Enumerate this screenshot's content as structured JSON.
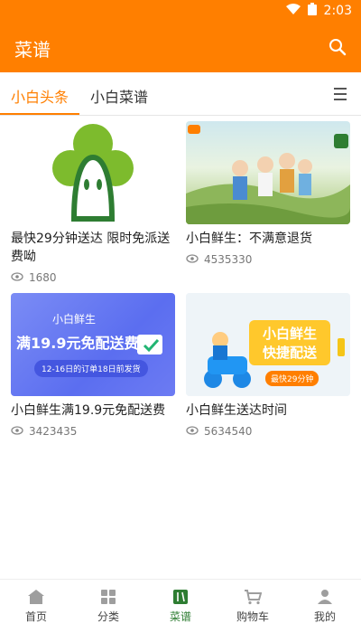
{
  "status": {
    "time": "2:03"
  },
  "app": {
    "title": "菜谱"
  },
  "tabs": [
    {
      "label": "小白头条"
    },
    {
      "label": "小白菜谱"
    }
  ],
  "cards": [
    {
      "title": "最快29分钟送达 限时免派送费呦",
      "views": "1680",
      "image": "green-brand-logo"
    },
    {
      "title": "小白鲜生：不满意退货",
      "views": "4535330",
      "image": "illustration-people-walking"
    },
    {
      "title": "小白鲜生满19.9元免配送费",
      "views": "3423435",
      "image": "banner-19.9-free-delivery",
      "banner": {
        "brand": "小白鲜生",
        "headline": "满19.9元免配送费",
        "note": "12-16日的订单18日前发货"
      }
    },
    {
      "title": "小白鲜生送达时间",
      "views": "5634540",
      "image": "banner-fast-delivery",
      "banner": {
        "line1": "小白鲜生",
        "line2": "快捷配送",
        "note": "最快29分钟"
      }
    }
  ],
  "nav": [
    {
      "label": "首页",
      "icon": "home-icon"
    },
    {
      "label": "分类",
      "icon": "category-icon"
    },
    {
      "label": "菜谱",
      "icon": "recipe-icon"
    },
    {
      "label": "购物车",
      "icon": "cart-icon"
    },
    {
      "label": "我的",
      "icon": "profile-icon"
    }
  ],
  "colors": {
    "primary": "#FF7F00",
    "active_nav": "#2E7D32"
  }
}
